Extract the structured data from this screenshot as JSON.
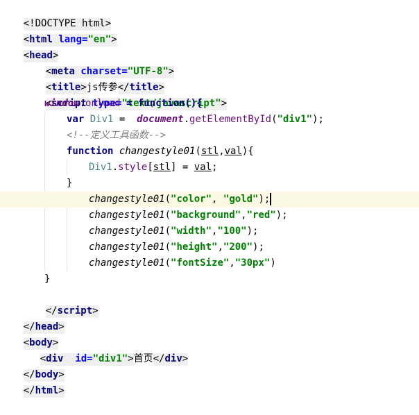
{
  "code": {
    "doctype": "<!DOCTYPE html>",
    "html_open": [
      "html",
      "lang",
      "\"en\""
    ],
    "head_open": "head",
    "meta": [
      "meta",
      "charset",
      "\"UTF-8\""
    ],
    "title_tag": "title",
    "title_text": "js传参",
    "script_open": [
      "script",
      "type",
      "\"text/javascript\""
    ],
    "window": "window",
    "onload": "onload",
    "assign_function": " = function(){",
    "var_kw": "var",
    "div1_var": "Div1",
    "equals": " =  ",
    "document": "document",
    "getById": "getElementById",
    "div1_str": "\"div1\"",
    "comment": "<!--定义工具函数-->",
    "function_kw": "function",
    "fn_name": "changestyle01",
    "param_stl": "stl",
    "param_val": "val",
    "style_prop": "style",
    "calls": [
      {
        "arg1": "\"color\"",
        "sep": ", ",
        "arg2": "\"gold\""
      },
      {
        "arg1": "\"background\"",
        "sep": ",",
        "arg2": "\"red\""
      },
      {
        "arg1": "\"width\"",
        "sep": ",",
        "arg2": "\"100\""
      },
      {
        "arg1": "\"height\"",
        "sep": ",",
        "arg2": "\"200\""
      },
      {
        "arg1": "\"fontSize\"",
        "sep": ",",
        "arg2": "\"30px\""
      }
    ],
    "script_tag": "script",
    "head_tag": "head",
    "body_tag": "body",
    "div_tag": "div",
    "div_id_attr": "id",
    "div_text": "首页",
    "html_tag": "html"
  }
}
